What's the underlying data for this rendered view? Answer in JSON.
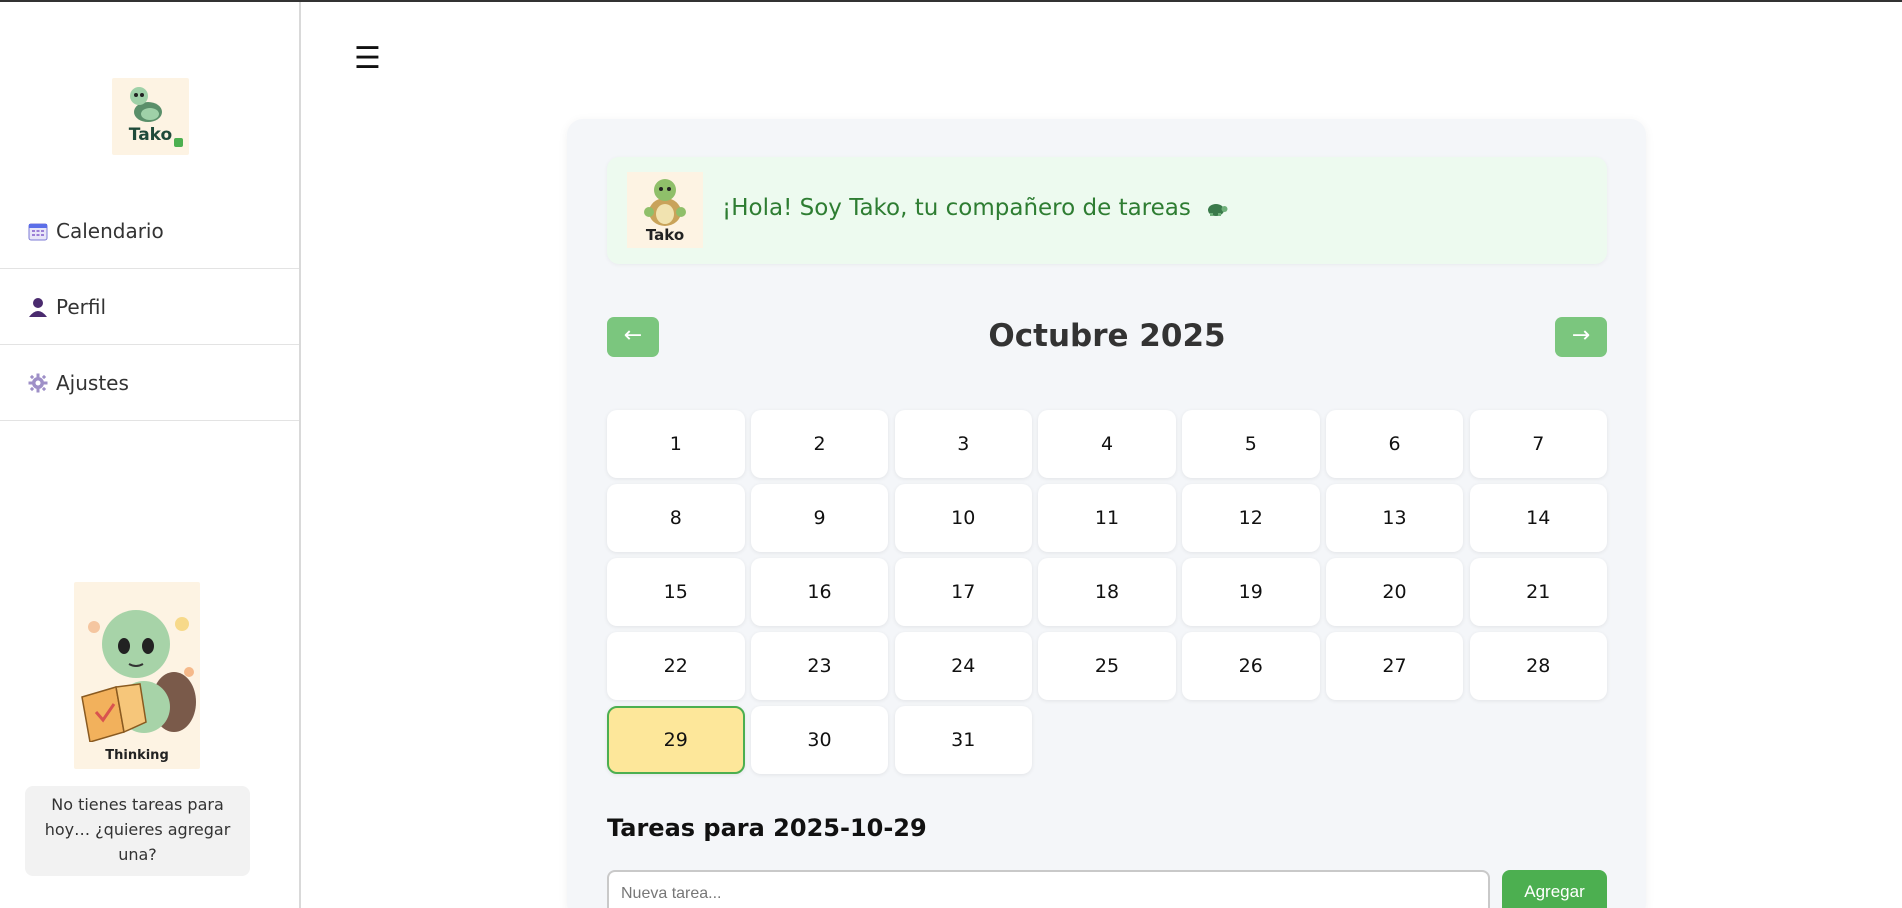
{
  "sidebar": {
    "logo_text": "Tako",
    "items": [
      {
        "label": "Calendario",
        "icon": "calendar-icon"
      },
      {
        "label": "Perfil",
        "icon": "user-icon"
      },
      {
        "label": "Ajustes",
        "icon": "gear-icon"
      }
    ],
    "mascot_label": "Thinking",
    "speech": "No tienes tareas para hoy… ¿quieres agregar una?"
  },
  "header": {
    "menu_icon": "☰"
  },
  "greeting": {
    "avatar_text": "Tako",
    "text": "¡Hola! Soy Tako, tu compañero de tareas"
  },
  "calendar": {
    "prev_label": "←",
    "next_label": "→",
    "month_title": "Octubre 2025",
    "days": [
      "1",
      "2",
      "3",
      "4",
      "5",
      "6",
      "7",
      "8",
      "9",
      "10",
      "11",
      "12",
      "13",
      "14",
      "15",
      "16",
      "17",
      "18",
      "19",
      "20",
      "21",
      "22",
      "23",
      "24",
      "25",
      "26",
      "27",
      "28",
      "29",
      "30",
      "31"
    ],
    "selected_day": "29"
  },
  "tasks": {
    "title": "Tareas para 2025-10-29",
    "input_placeholder": "Nueva tarea...",
    "add_label": "Agregar"
  },
  "colors": {
    "accent_green": "#4caf50",
    "nav_button_green": "#7bc67e",
    "greeting_text": "#2e7d32",
    "selected_day_bg": "#fde79a"
  }
}
